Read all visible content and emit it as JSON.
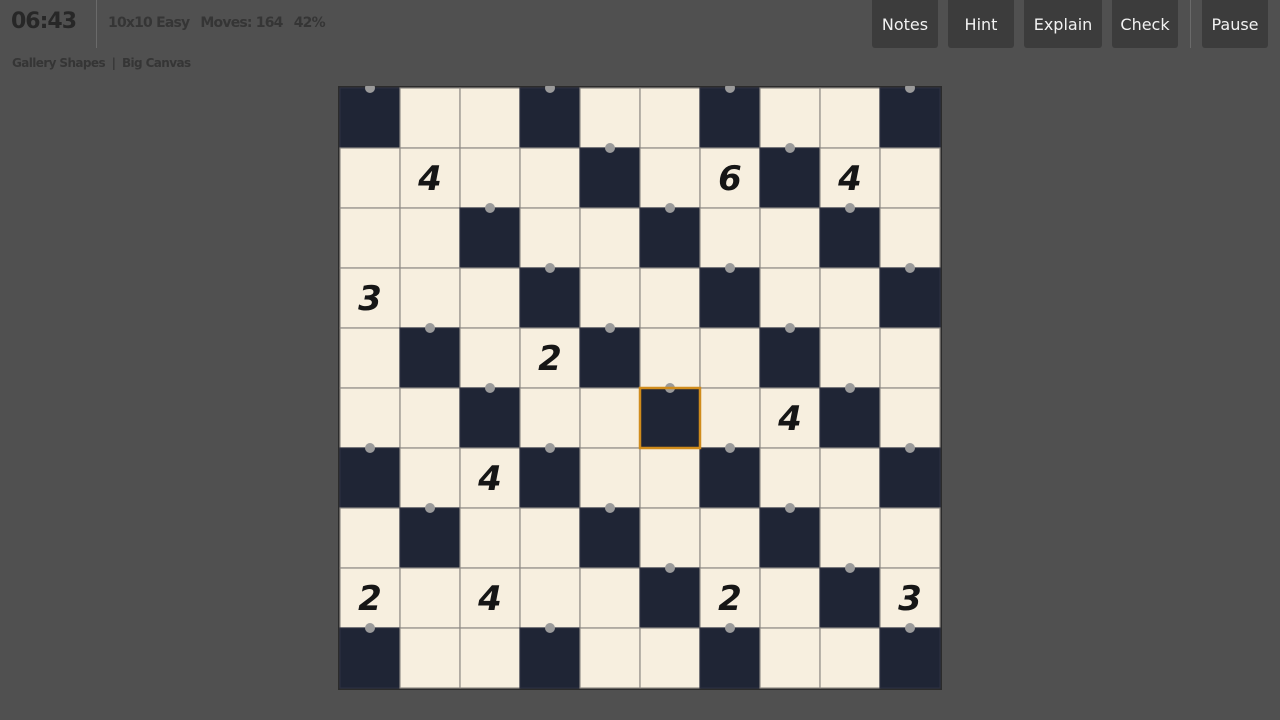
{
  "header": {
    "timer": "06:43",
    "puzzle_size": "10x10 Easy",
    "moves": "Moves: 164",
    "progress": "42%",
    "gallery_link": "Gallery Shapes",
    "separator": "|",
    "canvas_link": "Big Canvas"
  },
  "toolbar": {
    "notes_label": "Notes",
    "hint_label": "Hint",
    "explain_label": "Explain",
    "check_label": "Check",
    "pause_label": "Pause"
  },
  "colors": {
    "background": "#505050",
    "cell_light": "#f7efdf",
    "cell_dark": "#1f2535",
    "grid_line": "#8f8b85",
    "selection": "#d08c1c",
    "dot": "#9b9b9b",
    "clue_text": "#161616"
  },
  "board": {
    "rows": 10,
    "cols": 10,
    "dark_cells": [
      [
        0,
        0
      ],
      [
        0,
        3
      ],
      [
        0,
        6
      ],
      [
        0,
        9
      ],
      [
        1,
        4
      ],
      [
        1,
        7
      ],
      [
        2,
        2
      ],
      [
        2,
        5
      ],
      [
        2,
        8
      ],
      [
        3,
        3
      ],
      [
        3,
        6
      ],
      [
        3,
        9
      ],
      [
        4,
        1
      ],
      [
        4,
        4
      ],
      [
        4,
        7
      ],
      [
        5,
        2
      ],
      [
        5,
        5
      ],
      [
        5,
        8
      ],
      [
        6,
        0
      ],
      [
        6,
        3
      ],
      [
        6,
        6
      ],
      [
        6,
        9
      ],
      [
        7,
        1
      ],
      [
        7,
        4
      ],
      [
        7,
        7
      ],
      [
        8,
        5
      ],
      [
        8,
        8
      ],
      [
        9,
        0
      ],
      [
        9,
        3
      ],
      [
        9,
        6
      ],
      [
        9,
        9
      ]
    ],
    "clues": [
      {
        "row": 1,
        "col": 1,
        "value": "4"
      },
      {
        "row": 1,
        "col": 6,
        "value": "6"
      },
      {
        "row": 1,
        "col": 8,
        "value": "4"
      },
      {
        "row": 3,
        "col": 0,
        "value": "3"
      },
      {
        "row": 4,
        "col": 3,
        "value": "2"
      },
      {
        "row": 5,
        "col": 7,
        "value": "4"
      },
      {
        "row": 6,
        "col": 2,
        "value": "4"
      },
      {
        "row": 8,
        "col": 0,
        "value": "2"
      },
      {
        "row": 8,
        "col": 2,
        "value": "4"
      },
      {
        "row": 8,
        "col": 6,
        "value": "2"
      },
      {
        "row": 8,
        "col": 9,
        "value": "3"
      }
    ],
    "dots": [
      [
        0,
        0
      ],
      [
        0,
        3
      ],
      [
        0,
        6
      ],
      [
        0,
        9
      ],
      [
        1,
        4
      ],
      [
        1,
        7
      ],
      [
        2,
        2
      ],
      [
        2,
        5
      ],
      [
        2,
        8
      ],
      [
        3,
        3
      ],
      [
        3,
        6
      ],
      [
        3,
        9
      ],
      [
        4,
        1
      ],
      [
        4,
        4
      ],
      [
        4,
        7
      ],
      [
        5,
        2
      ],
      [
        5,
        5
      ],
      [
        5,
        8
      ],
      [
        6,
        0
      ],
      [
        6,
        3
      ],
      [
        6,
        6
      ],
      [
        6,
        9
      ],
      [
        7,
        1
      ],
      [
        7,
        4
      ],
      [
        7,
        7
      ],
      [
        8,
        5
      ],
      [
        8,
        8
      ],
      [
        9,
        0
      ],
      [
        9,
        3
      ],
      [
        9,
        6
      ],
      [
        9,
        9
      ]
    ],
    "selected": {
      "row": 5,
      "col": 5
    }
  }
}
